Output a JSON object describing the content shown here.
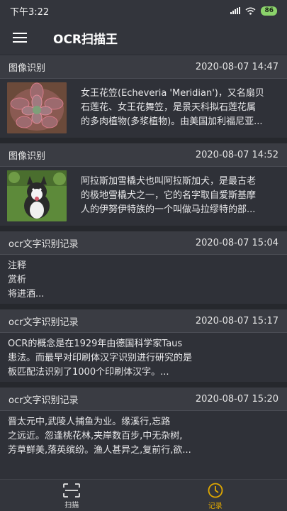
{
  "status": {
    "time": "下午3:22",
    "battery": "86"
  },
  "app": {
    "title": "OCR扫描王"
  },
  "records": [
    {
      "type": "图像识别",
      "datetime": "2020-08-07 14:47",
      "thumbnail": "succulent-thumbnail",
      "lines": [
        "女王花笠(Echeveria 'Meridian')，又名扇贝",
        "石莲花、女王花舞笠，是景天科拟石莲花属",
        "的多肉植物(多浆植物)。由美国加利福尼亚..."
      ]
    },
    {
      "type": "图像识别",
      "datetime": "2020-08-07 14:52",
      "thumbnail": "dog-thumbnail",
      "lines": [
        "阿拉斯加雪橇犬也叫阿拉斯加犬，是最古老",
        "的极地雪橇犬之一，它的名字取自爱斯基摩",
        "人的伊努伊特族的一个叫做马拉缪特的部..."
      ]
    },
    {
      "type": "ocr文字识别记录",
      "datetime": "2020-08-07 15:04",
      "lines": [
        "注释",
        "赏析",
        "将进酒..."
      ]
    },
    {
      "type": "ocr文字识别记录",
      "datetime": "2020-08-07 15:17",
      "lines": [
        "OCR的概念是在1929年由德国科学家Taus",
        "患法。而最早对印刷体汉字识别进行研究的是",
        "板匹配法识别了1000个印刷体汉字。..."
      ]
    },
    {
      "type": "ocr文字识别记录",
      "datetime": "2020-08-07 15:20",
      "lines": [
        "晋太元中,武陵人捕鱼为业。缘溪行,忘路",
        "之远近。忽逢桃花林,夹岸数百步,中无杂树,",
        "芳草鲜美,落英缤纷。渔人甚异之,复前行,欲..."
      ]
    }
  ],
  "nav": {
    "scan_label": "扫描",
    "records_label": "记录",
    "active_color": "#e0a800",
    "inactive_color": "#e6e6e6"
  }
}
